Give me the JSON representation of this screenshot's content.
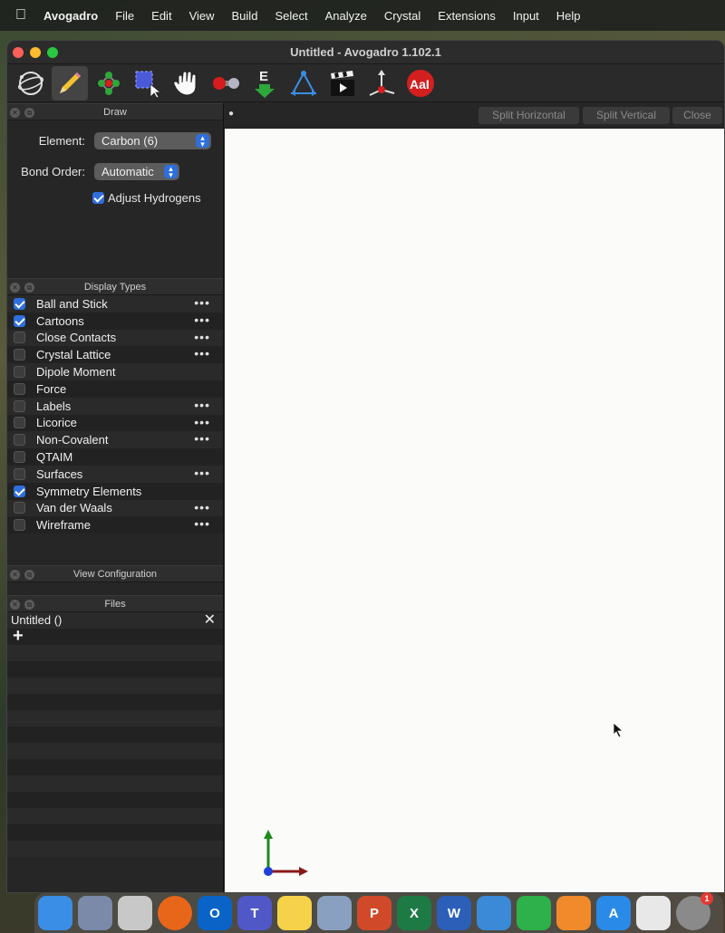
{
  "menubar": {
    "app_name": "Avogadro",
    "items": [
      "File",
      "Edit",
      "View",
      "Build",
      "Select",
      "Analyze",
      "Crystal",
      "Extensions",
      "Input",
      "Help"
    ]
  },
  "window": {
    "title": "Untitled - Avogadro 1.102.1"
  },
  "toolbar": {
    "tools": [
      {
        "name": "navigate-tool",
        "icon": "rotate-orbit-icon",
        "active": false
      },
      {
        "name": "draw-tool",
        "icon": "pencil-icon",
        "active": true
      },
      {
        "name": "template-tool",
        "icon": "molecule-template-icon",
        "active": false
      },
      {
        "name": "select-tool",
        "icon": "select-box-cursor-icon",
        "active": false
      },
      {
        "name": "manipulate-tool",
        "icon": "hand-icon",
        "active": false
      },
      {
        "name": "bond-centric-tool",
        "icon": "bond-manipulate-icon",
        "active": false
      },
      {
        "name": "auto-optimize-tool",
        "icon": "energy-down-icon",
        "active": false
      },
      {
        "name": "measure-tool",
        "icon": "measure-icon",
        "active": false
      },
      {
        "name": "animation-tool",
        "icon": "clapperboard-icon",
        "active": false
      },
      {
        "name": "align-tool",
        "icon": "axis-align-icon",
        "active": false
      },
      {
        "name": "label-tool",
        "icon": "label-text-icon",
        "active": false
      }
    ],
    "label_icon_text": "AaI"
  },
  "draw_panel": {
    "title": "Draw",
    "element_label": "Element:",
    "element_value": "Carbon (6)",
    "bond_order_label": "Bond Order:",
    "bond_order_value": "Automatic",
    "adjust_hydrogens_label": "Adjust Hydrogens",
    "adjust_hydrogens_checked": true
  },
  "display_types": {
    "title": "Display Types",
    "items": [
      {
        "label": "Ball and Stick",
        "checked": true,
        "has_options": true
      },
      {
        "label": "Cartoons",
        "checked": true,
        "has_options": true
      },
      {
        "label": "Close Contacts",
        "checked": false,
        "has_options": true
      },
      {
        "label": "Crystal Lattice",
        "checked": false,
        "has_options": true
      },
      {
        "label": "Dipole Moment",
        "checked": false,
        "has_options": false
      },
      {
        "label": "Force",
        "checked": false,
        "has_options": false
      },
      {
        "label": "Labels",
        "checked": false,
        "has_options": true
      },
      {
        "label": "Licorice",
        "checked": false,
        "has_options": true
      },
      {
        "label": "Non-Covalent",
        "checked": false,
        "has_options": true
      },
      {
        "label": "QTAIM",
        "checked": false,
        "has_options": false
      },
      {
        "label": "Surfaces",
        "checked": false,
        "has_options": true
      },
      {
        "label": "Symmetry Elements",
        "checked": true,
        "has_options": false
      },
      {
        "label": "Van der Waals",
        "checked": false,
        "has_options": true
      },
      {
        "label": "Wireframe",
        "checked": false,
        "has_options": true
      }
    ],
    "options_glyph": "•••"
  },
  "view_configuration": {
    "title": "View Configuration"
  },
  "files_panel": {
    "title": "Files",
    "files": [
      {
        "label": "Untitled ()"
      }
    ],
    "close_glyph": "✕",
    "add_glyph": "+"
  },
  "tabbar": {
    "split_horizontal": "Split Horizontal",
    "split_vertical": "Split Vertical",
    "close": "Close"
  },
  "dock": {
    "apps": [
      {
        "name": "finder",
        "icon": "finder-icon",
        "color": "#3a8ee6"
      },
      {
        "name": "preview",
        "icon": "preview-icon",
        "color": "#7a8aa8"
      },
      {
        "name": "launchpad",
        "icon": "launchpad-icon",
        "color": "#c8c8c8"
      },
      {
        "name": "firefox",
        "icon": "firefox-icon",
        "color": "#e8661a"
      },
      {
        "name": "outlook",
        "icon": "outlook-icon",
        "color": "#0a64c8"
      },
      {
        "name": "teams",
        "icon": "teams-icon",
        "color": "#5058c8"
      },
      {
        "name": "notes",
        "icon": "notes-icon",
        "color": "#f5d24a"
      },
      {
        "name": "photos-app",
        "icon": "photos-icon",
        "color": "#8aa0c0"
      },
      {
        "name": "powerpoint",
        "icon": "powerpoint-icon",
        "color": "#d04a2a"
      },
      {
        "name": "excel",
        "icon": "excel-icon",
        "color": "#1e7a45"
      },
      {
        "name": "word",
        "icon": "word-icon",
        "color": "#2b5fb8"
      },
      {
        "name": "keynote",
        "icon": "keynote-icon",
        "color": "#3a8ad8"
      },
      {
        "name": "numbers",
        "icon": "numbers-icon",
        "color": "#2eb04a"
      },
      {
        "name": "pages",
        "icon": "pages-icon",
        "color": "#f08a2a"
      },
      {
        "name": "app-store",
        "icon": "app-store-icon",
        "color": "#2a8ae8"
      },
      {
        "name": "slack",
        "icon": "slack-icon",
        "color": "#e8e8e8"
      },
      {
        "name": "system-settings",
        "icon": "settings-gear-icon",
        "color": "#8a8a8a"
      }
    ],
    "settings_badge": "1"
  }
}
